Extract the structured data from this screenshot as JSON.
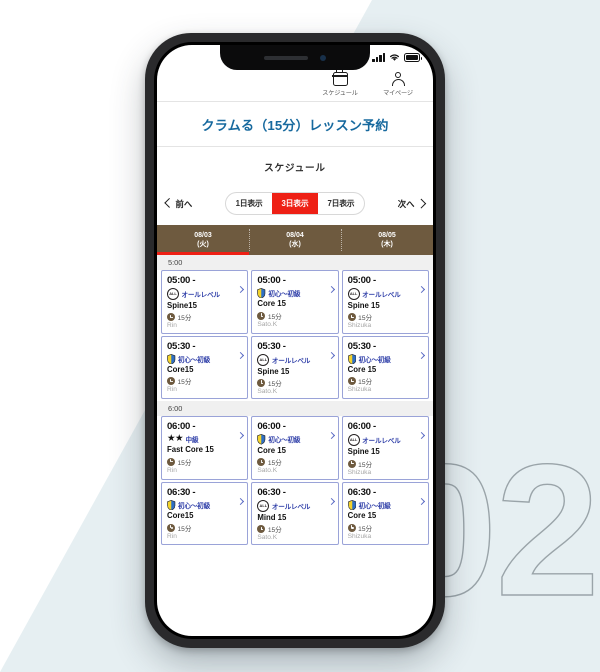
{
  "background": {
    "number": "02",
    "accent_color": "#e6eff2"
  },
  "status_bar": {
    "signal_icon": "signal-bars-icon",
    "wifi_icon": "wifi-icon",
    "battery_icon": "battery-icon"
  },
  "top_nav": [
    {
      "icon": "calendar-icon",
      "label": "スケジュール"
    },
    {
      "icon": "person-icon",
      "label": "マイページ"
    }
  ],
  "header": {
    "title": "クラムる（15分）レッスン予約",
    "subtitle": "スケジュール",
    "title_color": "#17699e"
  },
  "switcher": {
    "prev_label": "前へ",
    "next_label": "次へ",
    "options": [
      {
        "label": "1日表示",
        "active": false
      },
      {
        "label": "3日表示",
        "active": true
      },
      {
        "label": "7日表示",
        "active": false
      }
    ],
    "active_color": "#ee2015"
  },
  "date_strip": {
    "background_color": "#6e5a3f",
    "days": [
      {
        "date": "08/03",
        "weekday": "(火)",
        "selected": true
      },
      {
        "date": "08/04",
        "weekday": "(水)",
        "selected": false
      },
      {
        "date": "08/05",
        "weekday": "(木)",
        "selected": false
      }
    ]
  },
  "schedule": [
    {
      "time_label": "5:00",
      "rows": [
        {
          "cards": [
            {
              "time": "05:00 -",
              "badge": "all",
              "level": "オールレベル",
              "title": "Spine15",
              "duration": "15分",
              "instructor": "Rin"
            },
            {
              "time": "05:00 -",
              "badge": "shield",
              "level": "初心〜初級",
              "title": "Core 15",
              "duration": "15分",
              "instructor": "Sato.K"
            },
            {
              "time": "05:00 -",
              "badge": "all",
              "level": "オールレベル",
              "title": "Spine 15",
              "duration": "15分",
              "instructor": "Shizuka"
            }
          ]
        },
        {
          "cards": [
            {
              "time": "05:30 -",
              "badge": "shield",
              "level": "初心〜初級",
              "title": "Core15",
              "duration": "15分",
              "instructor": "Rin"
            },
            {
              "time": "05:30 -",
              "badge": "all",
              "level": "オールレベル",
              "title": "Spine 15",
              "duration": "15分",
              "instructor": "Sato.K"
            },
            {
              "time": "05:30 -",
              "badge": "shield",
              "level": "初心〜初級",
              "title": "Core 15",
              "duration": "15分",
              "instructor": "Shizuka"
            }
          ]
        }
      ]
    },
    {
      "time_label": "6:00",
      "rows": [
        {
          "cards": [
            {
              "time": "06:00 -",
              "badge": "stars",
              "level": "中級",
              "title": "Fast Core 15",
              "duration": "15分",
              "instructor": "Rin"
            },
            {
              "time": "06:00 -",
              "badge": "shield",
              "level": "初心〜初級",
              "title": "Core 15",
              "duration": "15分",
              "instructor": "Sato.K"
            },
            {
              "time": "06:00 -",
              "badge": "all",
              "level": "オールレベル",
              "title": "Spine 15",
              "duration": "15分",
              "instructor": "Shizuka"
            }
          ]
        },
        {
          "cards": [
            {
              "time": "06:30 -",
              "badge": "shield",
              "level": "初心〜初級",
              "title": "Core15",
              "duration": "15分",
              "instructor": "Rin"
            },
            {
              "time": "06:30 -",
              "badge": "all",
              "level": "オールレベル",
              "title": "Mind 15",
              "duration": "15分",
              "instructor": "Sato.K"
            },
            {
              "time": "06:30 -",
              "badge": "shield",
              "level": "初心〜初級",
              "title": "Core 15",
              "duration": "15分",
              "instructor": "Shizuka"
            }
          ]
        }
      ]
    }
  ],
  "badge_labels": {
    "all_text": "ALL",
    "star_glyph": "★"
  }
}
